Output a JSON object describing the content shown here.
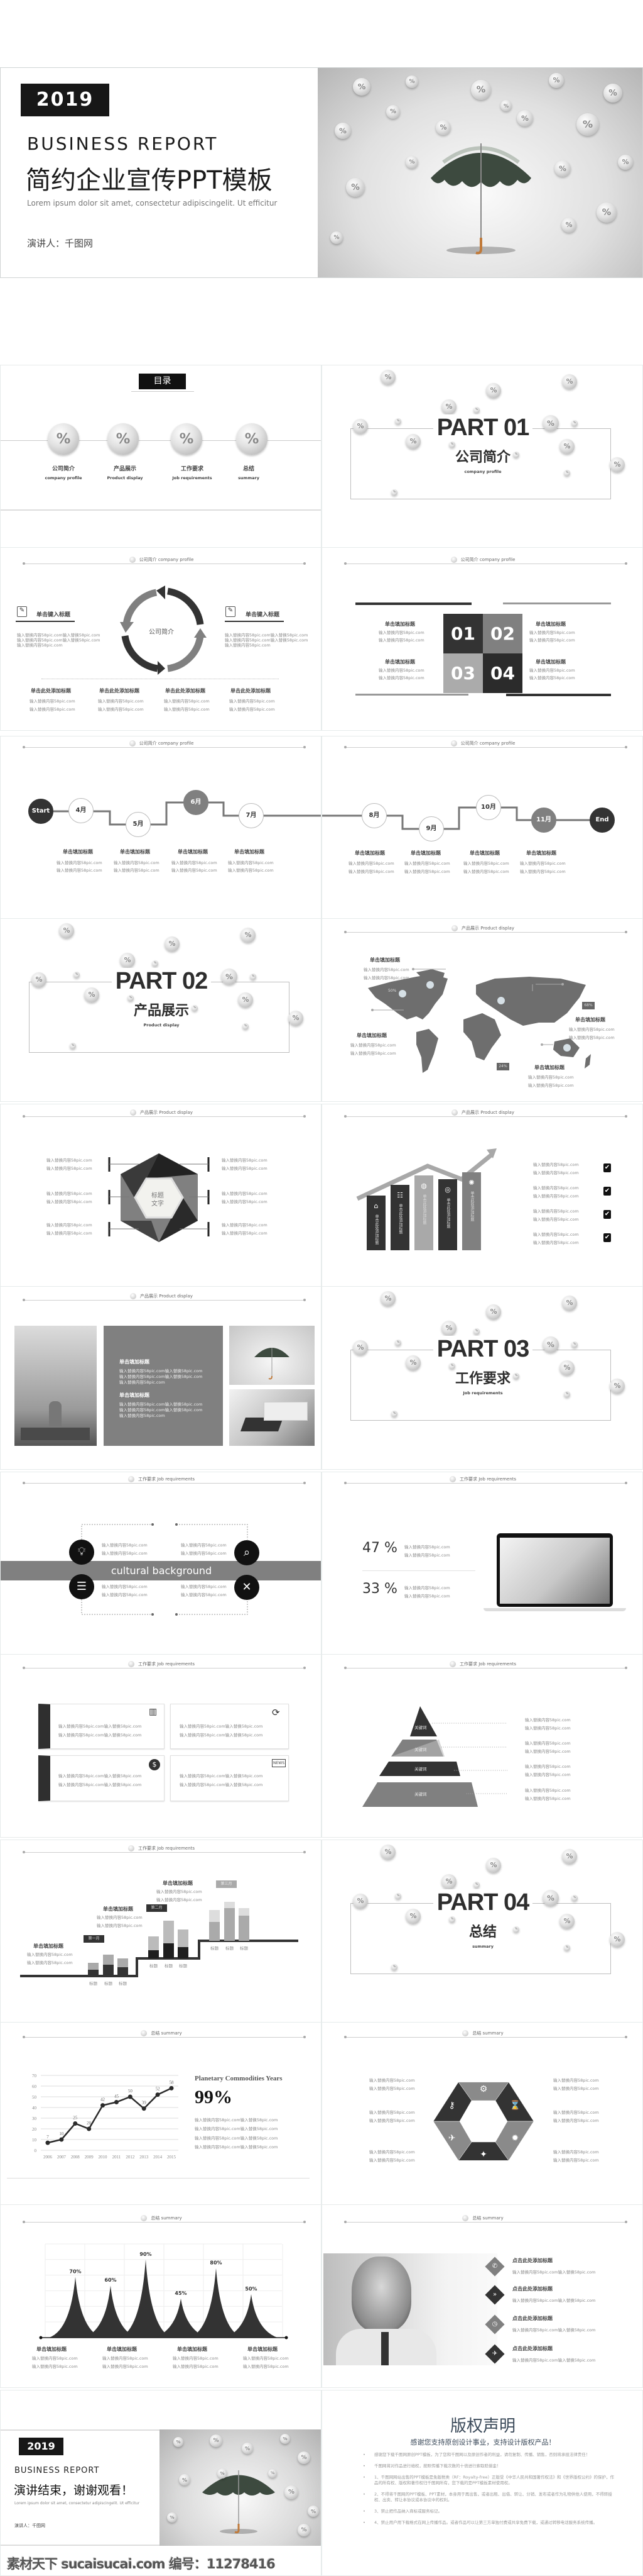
{
  "cover": {
    "year": "2019",
    "title_en": "BUSINESS REPORT",
    "title_cn": "简约企业宣传PPT模板",
    "subtitle": "Lorem ipsum dolor sit amet, consectetur adipiscingelit. Ut efficitur",
    "presenter": "演讲人：千图网"
  },
  "toc": {
    "title": "目录"
  },
  "sections": [
    {
      "cn": "公司简介",
      "en": "company profile"
    },
    {
      "cn": "产品展示",
      "en": "Product display"
    },
    {
      "cn": "工作要求",
      "en": "Job requirements"
    },
    {
      "cn": "总结",
      "en": "summary"
    }
  ],
  "parts": [
    "PART 01",
    "PART 02",
    "PART 03",
    "PART 04"
  ],
  "common": {
    "body": "输入替换内容58pic.com",
    "body_long": "输入替换内容58pic.com输入替换58pic.com",
    "add_title": "单击填加标题",
    "add_title_here": "单击此处添加标题",
    "type_title": "单击键入标题",
    "click_title": "点击此处添加标题",
    "keyword": "关键词",
    "label": "标题"
  },
  "cycle": {
    "center": "公司简介"
  },
  "quad": {
    "numbers": [
      "01",
      "02",
      "03",
      "04"
    ]
  },
  "timeline": {
    "nodes": [
      "Start",
      "4月",
      "5月",
      "6月",
      "7月",
      "8月",
      "9月",
      "10月",
      "11月",
      "End"
    ]
  },
  "map": {
    "badges": [
      "50%",
      "68%",
      "24%"
    ]
  },
  "hexagon": {
    "center_line1": "标题",
    "center_line2": "文字"
  },
  "culture": {
    "band": "cultural background"
  },
  "stats": {
    "values": [
      "47 %",
      "33 %"
    ]
  },
  "steps": {
    "months": [
      "第一月",
      "第二月",
      "第三月"
    ]
  },
  "planetary": {
    "title": "Planetary Commodities Years",
    "value": "99%"
  },
  "end": {
    "year": "2019",
    "title_en": "BUSINESS REPORT",
    "title_cn": "演讲结束，谢谢观看！",
    "subtitle": "Lorem ipsum dolor sit amet, consectetur adipiscingelit. Ut efficitur",
    "presenter": "演讲人：千图网"
  },
  "copyright": {
    "title": "版权声明",
    "subtitle": "感谢您支持原创设计事业，支持设计版权产品！",
    "items": [
      "感谢您下载千图网原创PPT模板，为了您和千图网以及原创作者的利益，请勿复制、传播、销售，否则将承担法律责任！",
      "千图网将对作品进行维权，按照传播下载次数的十倍进行索取赔偿金！",
      "1、千图网网站出售的PPT模板是免版税类（RF：Royalty-free）正版受《中华人民共和国著作权法》和《世界版权公约》的保护，作品的所有权、版权和著作权归千图网所有，您下载的是PPT模板素材使用权。",
      "2、不得将千图网的PPT模板、PPT素材，本身用于再出售，或者出租、出借、转让、分销、发布或者作为礼物供他人使用，不得转授权、出卖、转让本协议或本协议中的权利。",
      "3、禁止把作品纳入商标或服务标记。",
      "4、禁止用户用下载格式在网上传播作品。或者作品可以让第三方单独付费或共享免费下载，或通过转移电话服务系统传播。"
    ]
  },
  "watermark": "素材天下 sucaisucai.com  编号：11278416",
  "colors": {
    "dark": "#333333",
    "gray": "#808080",
    "light": "#bdbdbd",
    "copyright_title": "#3b4a5a"
  },
  "chart_data": [
    {
      "type": "line",
      "categories": [
        "2006",
        "2007",
        "2008",
        "2009",
        "2010",
        "2011",
        "2012",
        "2013",
        "2014",
        "2015"
      ],
      "values": [
        7,
        10,
        25,
        20,
        42,
        45,
        50,
        39,
        52,
        58
      ],
      "ylim": [
        0,
        70
      ],
      "yticks": [
        0,
        10,
        20,
        30,
        40,
        50,
        60,
        70
      ],
      "grid": true
    },
    {
      "type": "area",
      "values": [
        70,
        60,
        90,
        45,
        80,
        50
      ],
      "data_labels": [
        "70%",
        "60%",
        "90%",
        "45%",
        "80%",
        "50%"
      ],
      "ylim": [
        0,
        100
      ],
      "grid": true
    }
  ]
}
